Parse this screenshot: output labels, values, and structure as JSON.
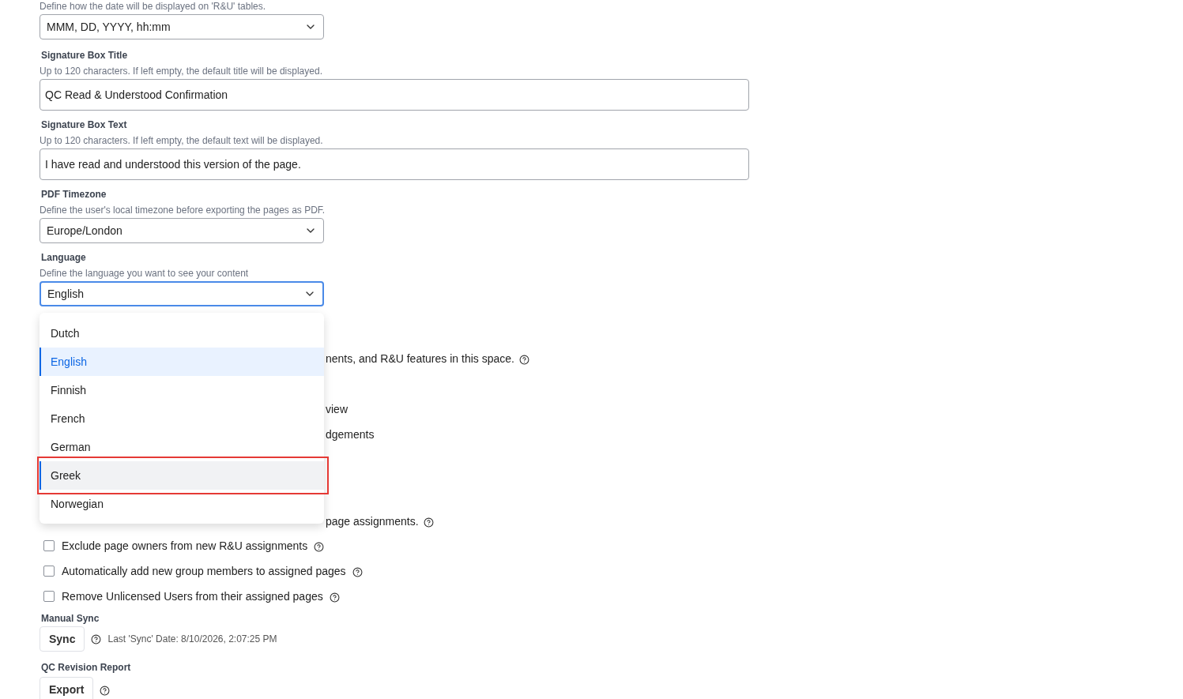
{
  "date_format": {
    "description": "Define how the date will be displayed on 'R&U' tables.",
    "value": "MMM, DD, YYYY, hh:mm"
  },
  "signature_title": {
    "label": "Signature Box Title",
    "description": "Up to 120 characters. If left empty, the default title will be displayed.",
    "value": "QC Read & Understood Confirmation"
  },
  "signature_text": {
    "label": "Signature Box Text",
    "description": "Up to 120 characters. If left empty, the default text will be displayed.",
    "value": "I have read and understood this version of the page."
  },
  "pdf_timezone": {
    "label": "PDF Timezone",
    "description": "Define the user's local timezone before exporting the pages as PDF.",
    "value": "Europe/London"
  },
  "language": {
    "label": "Language",
    "description": "Define the language you want to see your content",
    "value": "English",
    "expanded": true,
    "options": [
      {
        "label": "Dutch",
        "selected": false,
        "hovered": false,
        "highlighted": false
      },
      {
        "label": "English",
        "selected": true,
        "hovered": false,
        "highlighted": false
      },
      {
        "label": "Finnish",
        "selected": false,
        "hovered": false,
        "highlighted": false
      },
      {
        "label": "French",
        "selected": false,
        "hovered": false,
        "highlighted": false
      },
      {
        "label": "German",
        "selected": false,
        "hovered": false,
        "highlighted": false
      },
      {
        "label": "Greek",
        "selected": false,
        "hovered": true,
        "highlighted": true
      },
      {
        "label": "Norwegian",
        "selected": false,
        "hovered": false,
        "highlighted": false
      }
    ]
  },
  "covered_texts": [
    {
      "text": "nents, and R&U features in this space.",
      "help": true
    },
    {
      "text": "view",
      "help": false
    },
    {
      "text": "dgements",
      "help": false
    },
    {
      "text": "page assignments.",
      "help": true
    }
  ],
  "sync_options": [
    {
      "label": "Exclude page owners from new R&U assignments",
      "checked": false
    },
    {
      "label": "Automatically add new group members to assigned pages",
      "checked": false
    },
    {
      "label": "Remove Unlicensed Users from their assigned pages",
      "checked": false
    }
  ],
  "manual_sync": {
    "label": "Manual Sync",
    "button": "Sync",
    "last_sync": "Last 'Sync' Date: 8/10/2026, 2:07:25 PM"
  },
  "revision_report": {
    "label": "QC Revision Report",
    "button": "Export"
  }
}
